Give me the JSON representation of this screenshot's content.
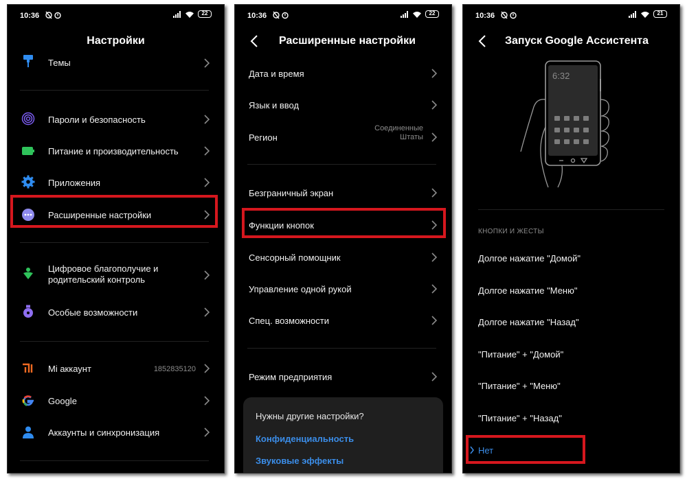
{
  "status": {
    "time": "10:36",
    "battery": [
      "22",
      "22",
      "21"
    ]
  },
  "screen1": {
    "title": "Настройки",
    "items": [
      {
        "label": "Темы",
        "icon": "paint-brush-icon"
      },
      {
        "label": "Пароли и безопасность",
        "icon": "fingerprint-icon"
      },
      {
        "label": "Питание и производительность",
        "icon": "battery-icon"
      },
      {
        "label": "Приложения",
        "icon": "gear-icon"
      },
      {
        "label": "Расширенные настройки",
        "icon": "more-dots-icon"
      },
      {
        "label": "Цифровое благополучие и родительский контроль",
        "icon": "wellbeing-icon"
      },
      {
        "label": "Особые возможности",
        "icon": "accessibility-icon"
      },
      {
        "label": "Mi аккаунт",
        "icon": "mi-logo-icon",
        "value": "1852835120"
      },
      {
        "label": "Google",
        "icon": "google-icon"
      },
      {
        "label": "Аккаунты и синхронизация",
        "icon": "account-icon"
      }
    ]
  },
  "screen2": {
    "title": "Расширенные настройки",
    "items": [
      {
        "label": "Дата и время"
      },
      {
        "label": "Язык и ввод"
      },
      {
        "label": "Регион",
        "value": "Соединенные Штаты"
      },
      {
        "label": "Безграничный экран"
      },
      {
        "label": "Функции кнопок"
      },
      {
        "label": "Сенсорный помощник"
      },
      {
        "label": "Управление одной рукой"
      },
      {
        "label": "Спец. возможности"
      },
      {
        "label": "Режим предприятия"
      }
    ],
    "card": {
      "question": "Нужны другие настройки?",
      "links": [
        "Конфиденциальность",
        "Звуковые эффекты"
      ]
    }
  },
  "screen3": {
    "title": "Запуск Google Ассистента",
    "illustration_clock": "6:32",
    "section": "КНОПКИ И ЖЕСТЫ",
    "options": [
      "Долгое нажатие \"Домой\"",
      "Долгое нажатие \"Меню\"",
      "Долгое нажатие \"Назад\"",
      "\"Питание\" + \"Домой\"",
      "\"Питание\" + \"Меню\"",
      "\"Питание\" + \"Назад\"",
      "Нет"
    ],
    "selected_index": 6
  },
  "colors": {
    "highlight": "#d5171e",
    "link": "#3b8de8",
    "background": "#000000"
  }
}
